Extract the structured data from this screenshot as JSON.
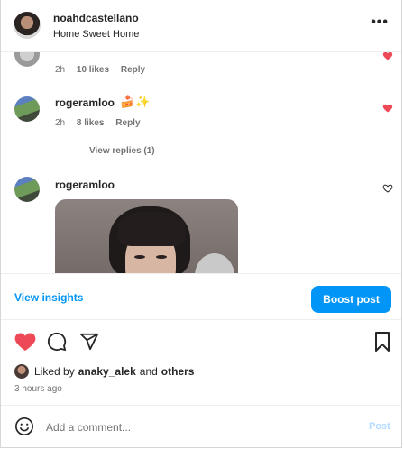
{
  "header": {
    "username": "noahdcastellano",
    "location": "Home Sweet Home",
    "more_icon": "more-horizontal-icon",
    "more_label": "•••"
  },
  "comments": [
    {
      "username": "",
      "text": "",
      "time": "2h",
      "likes": "10 likes",
      "reply": "Reply",
      "liked": true
    },
    {
      "username": "rogeramloo",
      "emojis": [
        "cake-emoji",
        "sparkle-bee-emoji"
      ],
      "time": "2h",
      "likes": "8 likes",
      "reply": "Reply",
      "liked": true,
      "view_replies": "View replies (1)"
    },
    {
      "username": "rogeramloo",
      "liked": false,
      "has_photo": true
    }
  ],
  "insights": {
    "view_insights": "View insights",
    "boost_post": "Boost post"
  },
  "actions": {
    "like_icon": "heart-filled-icon",
    "comment_icon": "comment-icon",
    "share_icon": "share-icon",
    "save_icon": "bookmark-icon"
  },
  "likes_summary": {
    "prefix": "Liked by",
    "user": "anaky_alek",
    "and": "and",
    "others": "others"
  },
  "time_ago": "3 hours ago",
  "comment_box": {
    "placeholder": "Add a comment...",
    "post_label": "Post",
    "emoji_icon": "smiley-icon"
  },
  "colors": {
    "accent": "#0095f6",
    "like_red": "#ed4956",
    "muted": "#737373",
    "post_disabled": "#b3dbff"
  }
}
